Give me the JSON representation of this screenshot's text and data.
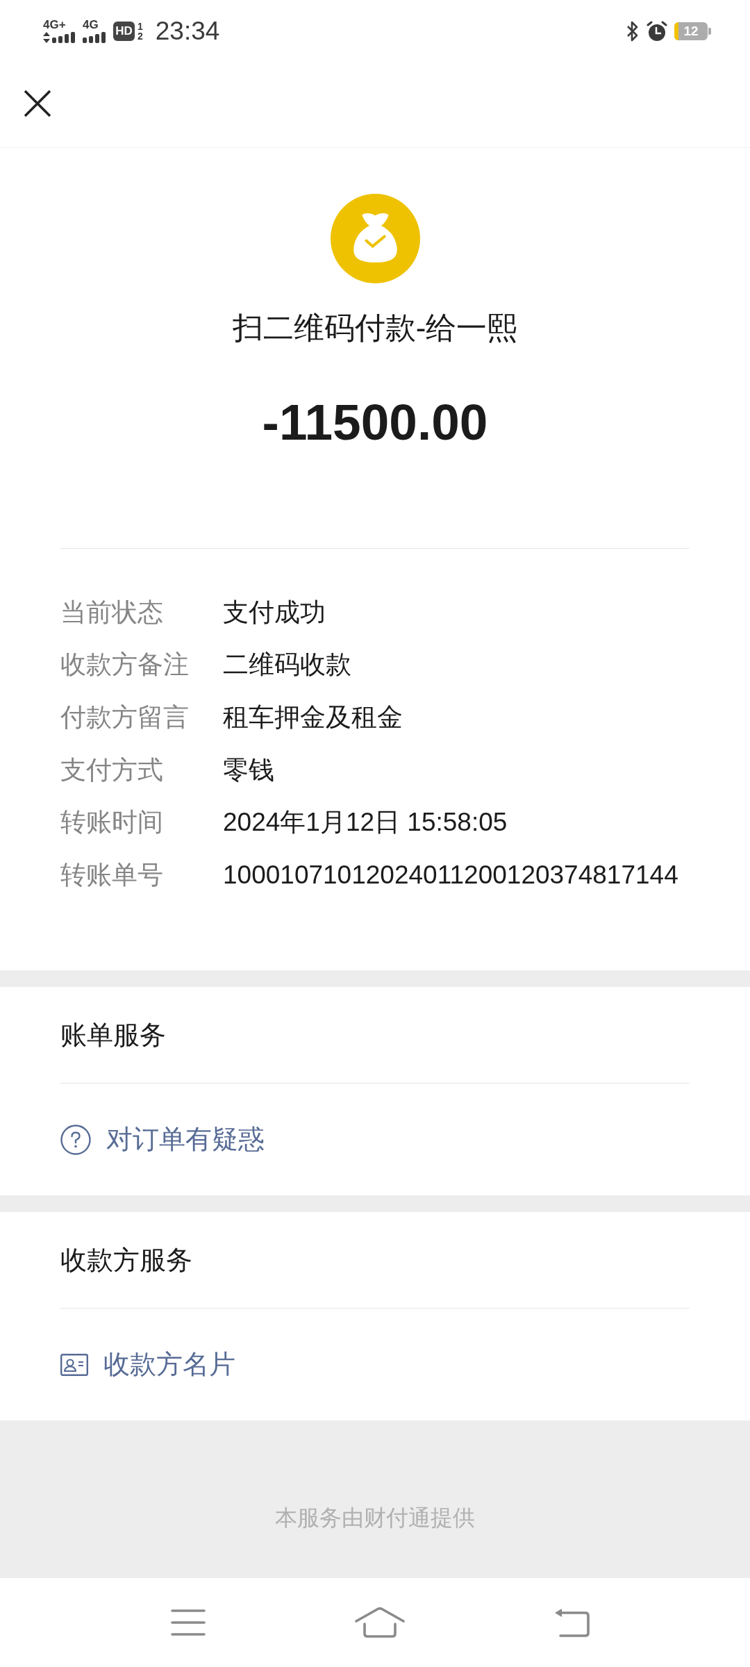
{
  "status_bar": {
    "signals": [
      {
        "label": "4G+",
        "activity": true
      },
      {
        "label": "4G",
        "activity": false
      }
    ],
    "hd": "HD",
    "sim_slots": [
      "1",
      "2"
    ],
    "time": "23:34",
    "battery": "12"
  },
  "payment": {
    "title": "扫二维码付款-给一熙",
    "amount": "-11500.00"
  },
  "details": [
    {
      "label": "当前状态",
      "value": "支付成功"
    },
    {
      "label": "收款方备注",
      "value": "二维码收款"
    },
    {
      "label": "付款方留言",
      "value": "租车押金及租金"
    },
    {
      "label": "支付方式",
      "value": "零钱"
    },
    {
      "label": "转账时间",
      "value": "2024年1月12日 15:58:05"
    },
    {
      "label": "转账单号",
      "value": "10001071012024011200120374817144"
    }
  ],
  "sections": [
    {
      "title": "账单服务",
      "items": [
        {
          "kind": "help",
          "label": "对订单有疑惑"
        }
      ]
    },
    {
      "title": "收款方服务",
      "items": [
        {
          "kind": "card",
          "label": "收款方名片"
        }
      ]
    }
  ],
  "footer": "本服务由财付通提供"
}
